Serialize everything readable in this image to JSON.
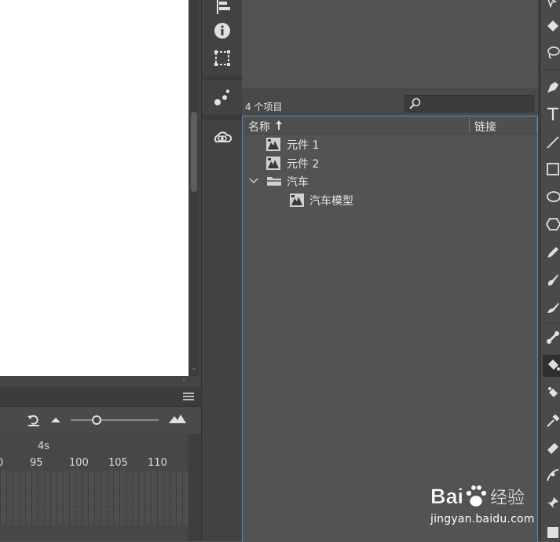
{
  "timeline": {
    "time_marker": "4s",
    "ruler_labels": [
      "0",
      "95",
      "100",
      "105",
      "110"
    ]
  },
  "library": {
    "item_count": "4 个项目",
    "search": {
      "placeholder": "",
      "value": ""
    },
    "columns": {
      "name": "名称",
      "link": "链接"
    },
    "items": [
      {
        "label": "元件 1",
        "type": "symbol",
        "level": 0
      },
      {
        "label": "元件 2",
        "type": "symbol",
        "level": 0
      },
      {
        "label": "汽车",
        "type": "folder",
        "level": 0,
        "expanded": true
      },
      {
        "label": "汽车模型",
        "type": "symbol",
        "level": 1
      }
    ]
  },
  "watermark": {
    "brand_text": "Bai  经验",
    "url": "jingyan.baidu.com"
  },
  "colors": {
    "panel_bg": "#535353",
    "selection_border": "#4a90d9",
    "canvas": "#ffffff"
  },
  "icons": {
    "dock": [
      "align-icon",
      "info-icon",
      "transform-icon",
      "assets-icon",
      "cc-libraries-icon"
    ],
    "tools": [
      "subselect-icon",
      "3d-rotate-icon",
      "lasso-icon",
      "pen-icon",
      "text-icon",
      "line-icon",
      "rectangle-icon",
      "oval-icon",
      "polystar-icon",
      "pencil-icon",
      "paint-brush-icon",
      "brush-icon",
      "bone-icon",
      "paint-bucket-icon",
      "ink-bottle-icon",
      "eyedropper-icon",
      "eraser-icon",
      "width-icon",
      "pin-icon",
      "stroke-color-icon"
    ]
  }
}
